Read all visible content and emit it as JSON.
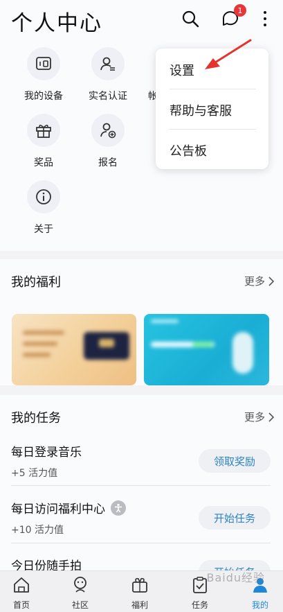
{
  "header": {
    "title": "个人中心",
    "notification_count": "1"
  },
  "services": [
    {
      "label": "我的设备",
      "icon": "device-icon"
    },
    {
      "label": "实名认证",
      "icon": "id-verify-icon"
    },
    {
      "label": "帐",
      "icon": "account-icon"
    },
    {
      "label": "奖品",
      "icon": "gift-icon"
    },
    {
      "label": "报名",
      "icon": "signup-icon"
    },
    {
      "label": "关于",
      "icon": "info-icon"
    }
  ],
  "dropdown": {
    "items": [
      "设置",
      "帮助与客服",
      "公告板"
    ]
  },
  "welfare": {
    "title": "我的福利",
    "more": "更多"
  },
  "tasks": {
    "title": "我的任务",
    "more": "更多",
    "items": [
      {
        "name": "每日登录音乐",
        "reward": "+5 活力值",
        "button": "领取奖励"
      },
      {
        "name": "每日访问福利中心",
        "reward": "+10 活力值",
        "button": "开始任务"
      },
      {
        "name": "今日份随手拍",
        "button": "开始任务"
      }
    ]
  },
  "nav": {
    "items": [
      "首页",
      "社区",
      "福利",
      "任务",
      "我的"
    ],
    "active_color": "#1e88d6"
  },
  "watermark": "Baidu经验"
}
